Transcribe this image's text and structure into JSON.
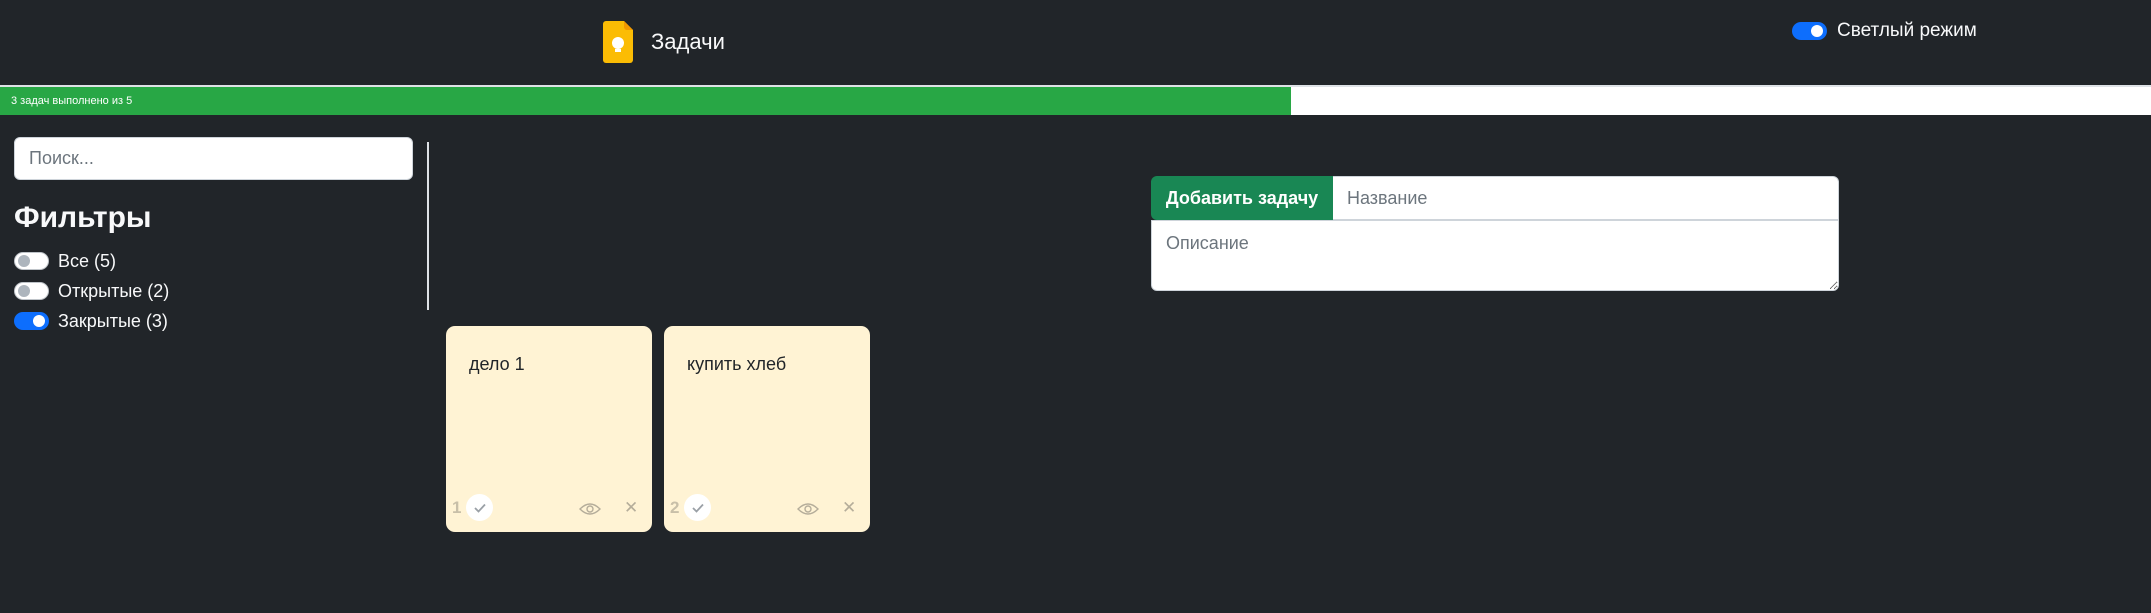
{
  "header": {
    "title": "Задачи",
    "icon": "lightbulb-note-icon",
    "theme_toggle": {
      "label": "Светлый режим",
      "checked": true
    }
  },
  "progress": {
    "text": "3 задач выполнено из 5",
    "completed": 3,
    "total": 5
  },
  "sidebar": {
    "search_placeholder": "Поиск...",
    "filters_title": "Фильтры",
    "filters": [
      {
        "label": "Все (5)",
        "checked": false
      },
      {
        "label": "Открытые (2)",
        "checked": false
      },
      {
        "label": "Закрытые (3)",
        "checked": true
      }
    ]
  },
  "add_form": {
    "button_label": "Добавить задачу",
    "title_placeholder": "Название",
    "description_placeholder": "Описание"
  },
  "tasks": [
    {
      "number": "1",
      "text": "дело 1"
    },
    {
      "number": "2",
      "text": "купить хлеб"
    }
  ],
  "colors": {
    "background": "#212529",
    "progress": "#28a745",
    "accent": "#0d6efd",
    "add_button": "#198754",
    "card": "#fff3d4",
    "brand_icon": "#fbbc04"
  }
}
